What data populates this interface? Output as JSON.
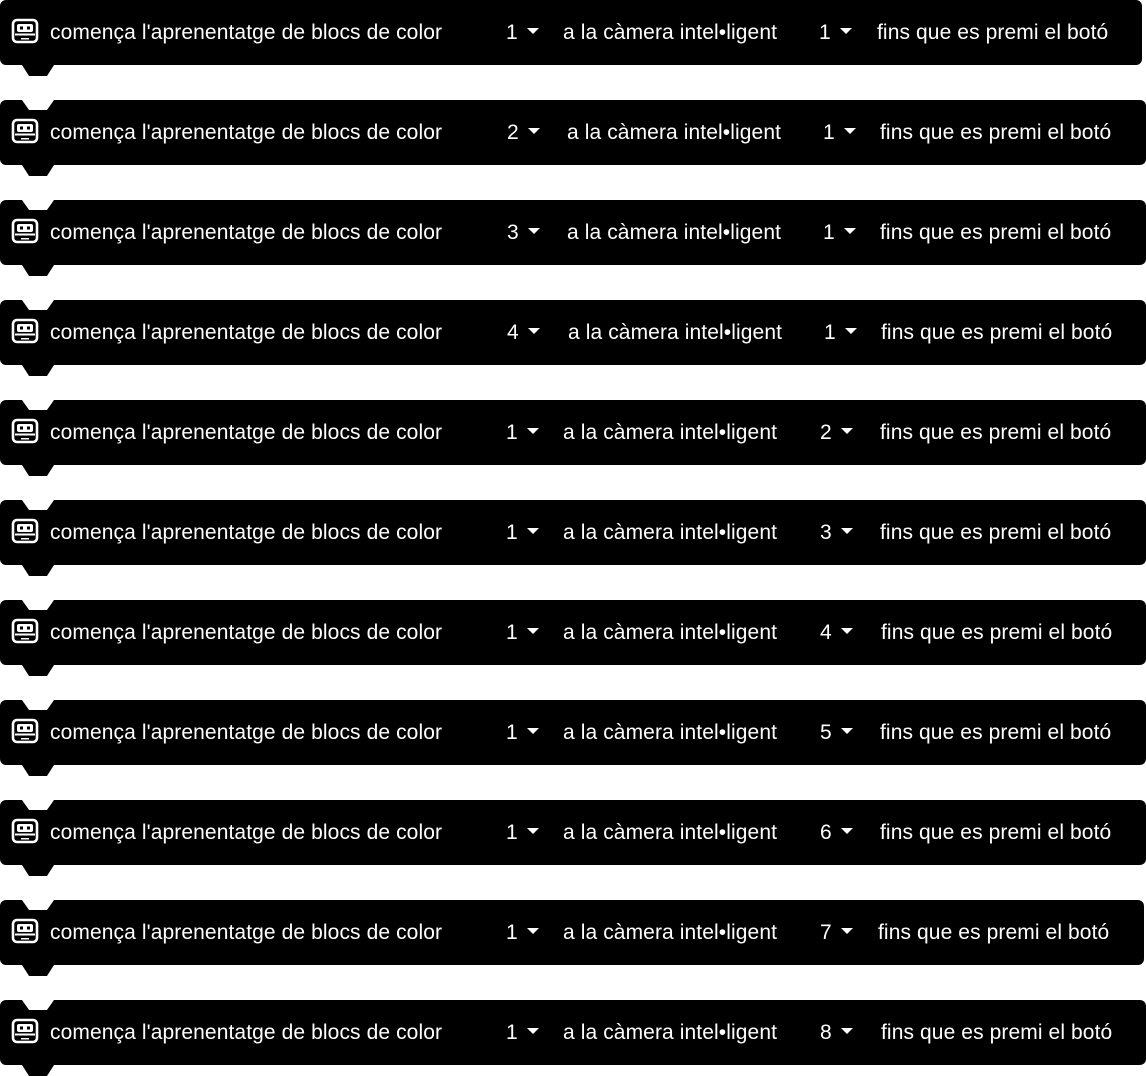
{
  "blocks": [
    {
      "label_start": "comença l'aprenentatge de blocs de color",
      "color_block": "1",
      "label_mid": "a la càmera intel•ligent",
      "camera": "1",
      "label_end": "fins que es premi el botó"
    },
    {
      "label_start": "comença l'aprenentatge de blocs de color",
      "color_block": "2",
      "label_mid": "a la càmera intel•ligent",
      "camera": "1",
      "label_end": "fins que es premi el botó"
    },
    {
      "label_start": "comença l'aprenentatge de blocs de color",
      "color_block": "3",
      "label_mid": "a la càmera intel•ligent",
      "camera": "1",
      "label_end": "fins que es premi el botó"
    },
    {
      "label_start": "comença l'aprenentatge de blocs de color",
      "color_block": "4",
      "label_mid": "a la càmera intel•ligent",
      "camera": "1",
      "label_end": "fins que es premi el botó"
    },
    {
      "label_start": "comença l'aprenentatge de blocs de color",
      "color_block": "1",
      "label_mid": "a la càmera intel•ligent",
      "camera": "2",
      "label_end": "fins que es premi el botó"
    },
    {
      "label_start": "comença l'aprenentatge de blocs de color",
      "color_block": "1",
      "label_mid": "a la càmera intel•ligent",
      "camera": "3",
      "label_end": "fins que es premi el botó"
    },
    {
      "label_start": "comença l'aprenentatge de blocs de color",
      "color_block": "1",
      "label_mid": "a la càmera intel•ligent",
      "camera": "4",
      "label_end": "fins que es premi el botó"
    },
    {
      "label_start": "comença l'aprenentatge de blocs de color",
      "color_block": "1",
      "label_mid": "a la càmera intel•ligent",
      "camera": "5",
      "label_end": "fins que es premi el botó"
    },
    {
      "label_start": "comença l'aprenentatge de blocs de color",
      "color_block": "1",
      "label_mid": "a la càmera intel•ligent",
      "camera": "6",
      "label_end": "fins que es premi el botó"
    },
    {
      "label_start": "comença l'aprenentatge de blocs de color",
      "color_block": "1",
      "label_mid": "a la càmera intel•ligent",
      "camera": "7",
      "label_end": "fins que es premi el botó"
    },
    {
      "label_start": "comença l'aprenentatge de blocs de color",
      "color_block": "1",
      "label_mid": "a la càmera intel•ligent",
      "camera": "8",
      "label_end": "fins que es premi el botó"
    }
  ],
  "icons": {
    "block_icon": "smart-camera-icon"
  },
  "colors": {
    "block_bg": "#000000",
    "text": "#ffffff"
  }
}
